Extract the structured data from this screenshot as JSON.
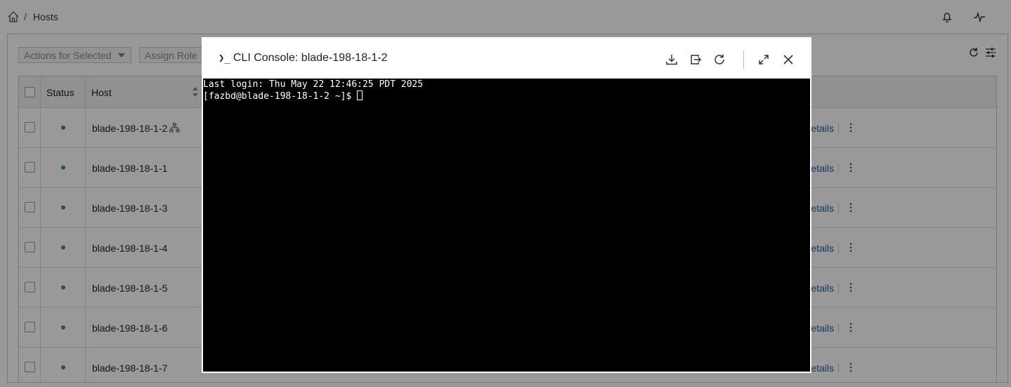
{
  "breadcrumb": {
    "separator": "/",
    "page": "Hosts"
  },
  "toolbar": {
    "actions_label": "Actions for Selected",
    "assign_label": "Assign Role"
  },
  "table": {
    "columns": {
      "status": "Status",
      "host": "Host"
    },
    "rows": [
      {
        "host": "blade-198-18-1-2",
        "status": "online",
        "details": "Details"
      },
      {
        "host": "blade-198-18-1-1",
        "status": "online",
        "details": "Details"
      },
      {
        "host": "blade-198-18-1-3",
        "status": "online",
        "details": "Details"
      },
      {
        "host": "blade-198-18-1-4",
        "status": "online",
        "details": "Details"
      },
      {
        "host": "blade-198-18-1-5",
        "status": "online",
        "details": "Details"
      },
      {
        "host": "blade-198-18-1-6",
        "status": "online",
        "details": "Details"
      },
      {
        "host": "blade-198-18-1-7",
        "status": "online",
        "details": "Details"
      }
    ]
  },
  "modal": {
    "title": "CLI Console: blade-198-18-1-2",
    "prompt_glyph": "❯_",
    "terminal": {
      "line1": "Last login: Thu May 22 12:46:25 PDT 2025",
      "line2": "[fazbd@blade-198-18-1-2 ~]$ "
    },
    "icons": [
      "download-icon",
      "export-icon",
      "refresh-icon",
      "expand-icon",
      "close-icon"
    ]
  },
  "colors": {
    "status_online": "#3a9b3a",
    "link": "#1a5ea8",
    "terminal_bg": "#000000"
  }
}
